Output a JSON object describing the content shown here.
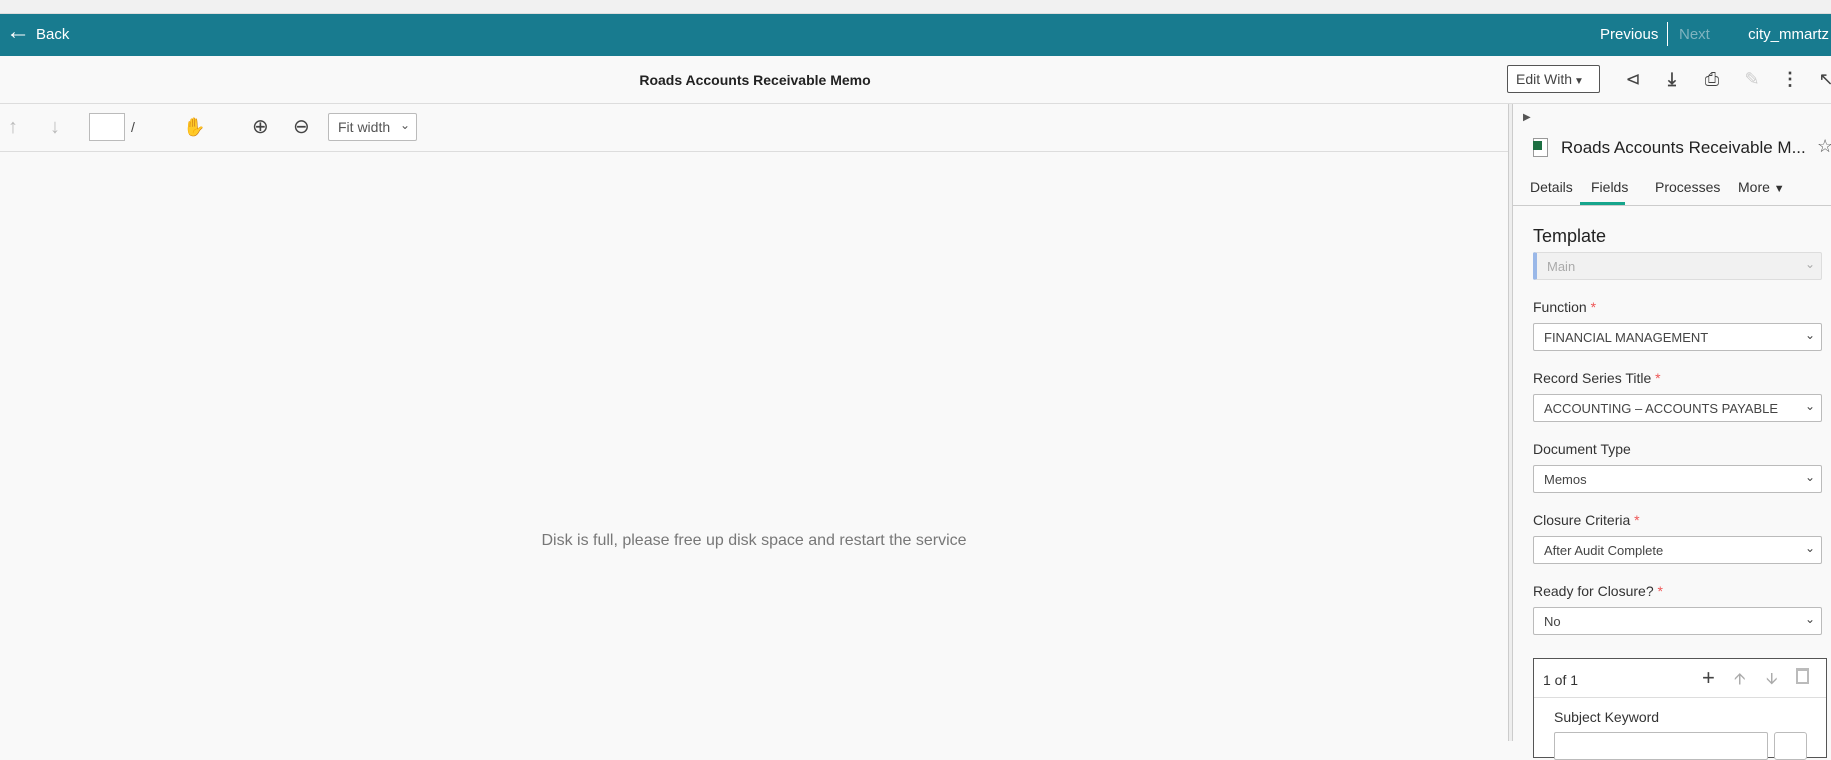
{
  "header": {
    "back_label": "Back",
    "previous_label": "Previous",
    "next_label": "Next",
    "user": "city_mmartz",
    "color": "#187b8f"
  },
  "titlebar": {
    "title": "Roads Accounts Receivable Memo",
    "edit_with_label": "Edit With"
  },
  "viewer_toolbar": {
    "page_value": "",
    "page_separator": "/",
    "zoom_mode": "Fit width"
  },
  "viewer": {
    "message": "Disk is full, please free up disk space and restart the service"
  },
  "panel": {
    "doc_title": "Roads Accounts Receivable M...",
    "tabs": [
      {
        "label": "Details"
      },
      {
        "label": "Fields",
        "active": true
      },
      {
        "label": "Processes"
      },
      {
        "label": "More"
      }
    ],
    "template_heading": "Template",
    "template_value": "Main",
    "fields": [
      {
        "label": "Function",
        "required": "*",
        "value": "FINANCIAL MANAGEMENT"
      },
      {
        "label": "Record Series Title",
        "required": "*",
        "value": "ACCOUNTING – ACCOUNTS PAYABLE"
      },
      {
        "label": "Document Type",
        "required": "",
        "value": "Memos"
      },
      {
        "label": "Closure Criteria",
        "required": "*",
        "value": "After Audit Complete"
      },
      {
        "label": "Ready for Closure?",
        "required": "*",
        "value": "No"
      }
    ],
    "multi": {
      "counter": "1 of 1",
      "subject_label": "Subject Keyword"
    }
  }
}
